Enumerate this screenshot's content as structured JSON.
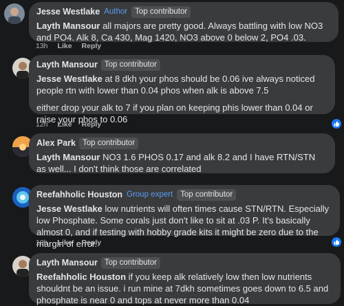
{
  "comments": [
    {
      "author": "Jesse Westlake",
      "badges": [
        "Author",
        "Top contributor"
      ],
      "mention": "Layth Mansour",
      "text": " all majors are pretty good. Always battling with low NO3 and PO4. Alk 8, Ca 430, Mag 1420, NO3 above 0 below 2, PO4 .03.",
      "time": "13h",
      "like": "Like",
      "reply": "Reply"
    },
    {
      "author": "Layth Mansour",
      "badges": [
        "Top contributor"
      ],
      "mention": "Jesse Westlake",
      "text": " at 8 dkh your phos should be 0.06 ive always noticed people rtn with lower than 0.04 phos when alk is above 7.5",
      "text2": "either drop your alk to 7 if you plan on keeping phis lower than 0.04 or raise your phos to 0.06",
      "time": "12h",
      "like": "Like",
      "reply": "Reply"
    },
    {
      "author": "Alex Park",
      "badges": [
        "Top contributor"
      ],
      "mention": "Layth Mansour",
      "text": " NO3 1.6 PHOS 0.17 and alk 8.2 and I have RTN/STN as well... I don't think those are correlated",
      "time": "12h",
      "like": "Like",
      "reply": "Reply"
    },
    {
      "author": "Reefahholic Houston",
      "badges": [
        "Group expert",
        "Top contributor"
      ],
      "mention": "Jesse Westlake",
      "text": " low nutrients will often times cause STN/RTN. Especially low Phosphate. Some corals just don't like to sit at .03 P. It's basically almost 0, and if testing with hobby grade kits it might be zero due to the margin of error.",
      "time": "10h",
      "like": "Like",
      "reply": "Reply"
    },
    {
      "author": "Layth Mansour",
      "badges": [
        "Top contributor"
      ],
      "mention": "Reefahholic Houston",
      "text": " if you keep alk relatively low then low nutrients shouldnt be an issue. i run mine at 7dkh sometimes goes down to 6.5 and phosphate is near 0 and tops at never more than 0.04"
    }
  ]
}
